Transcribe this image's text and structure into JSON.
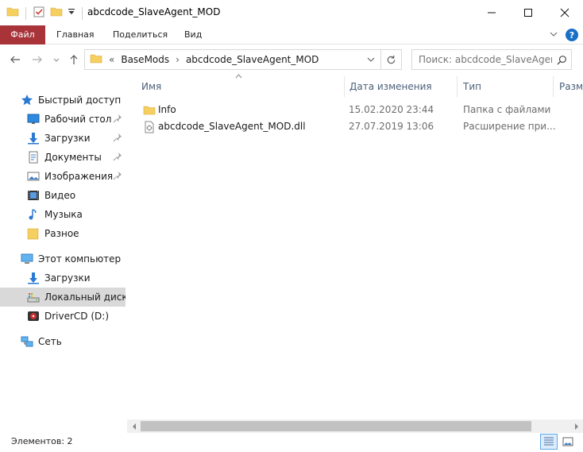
{
  "window": {
    "title": "abcdcode_SlaveAgent_MOD",
    "controls": [
      "—",
      "☐",
      "✕"
    ]
  },
  "ribbon": {
    "tabs": [
      "Файл",
      "Главная",
      "Поделиться",
      "Вид"
    ]
  },
  "address": {
    "prefix": "«",
    "crumbs": [
      "BaseMods",
      "abcdcode_SlaveAgent_MOD"
    ],
    "separator": "›"
  },
  "search": {
    "placeholder": "Поиск: abcdcode_SlaveAgent..."
  },
  "sidebar": {
    "items": [
      {
        "label": "Быстрый доступ",
        "icon": "star-icon",
        "pinned": false
      },
      {
        "label": "Рабочий стол",
        "icon": "desktop-icon",
        "pinned": true
      },
      {
        "label": "Загрузки",
        "icon": "download-icon",
        "pinned": true
      },
      {
        "label": "Документы",
        "icon": "documents-icon",
        "pinned": true
      },
      {
        "label": "Изображения",
        "icon": "pictures-icon",
        "pinned": true
      },
      {
        "label": "Видео",
        "icon": "video-icon",
        "pinned": false
      },
      {
        "label": "Музыка",
        "icon": "music-icon",
        "pinned": false
      },
      {
        "label": "Разное",
        "icon": "folder-icon",
        "pinned": false
      },
      {
        "label": "Этот компьютер",
        "icon": "computer-icon",
        "pinned": false
      },
      {
        "label": "Загрузки",
        "icon": "download-icon",
        "pinned": false
      },
      {
        "label": "Локальный диск (C:)",
        "icon": "drive-icon",
        "pinned": false
      },
      {
        "label": "DriverCD (D:)",
        "icon": "cd-drive-icon",
        "pinned": false
      },
      {
        "label": "Сеть",
        "icon": "network-icon",
        "pinned": false
      }
    ]
  },
  "columns": [
    "Имя",
    "Дата изменения",
    "Тип",
    "Разме"
  ],
  "files": [
    {
      "name": "Info",
      "date": "15.02.2020 23:44",
      "type": "Папка с файлами",
      "icon": "folder-icon"
    },
    {
      "name": "abcdcode_SlaveAgent_MOD.dll",
      "date": "27.07.2019 13:06",
      "type": "Расширение при...",
      "icon": "dll-file-icon"
    }
  ],
  "status": {
    "count_text": "Элементов: 2"
  },
  "colors": {
    "file_tab": "#a8343a",
    "accent": "#1a6fc7",
    "folder": "#f5cf5f"
  }
}
